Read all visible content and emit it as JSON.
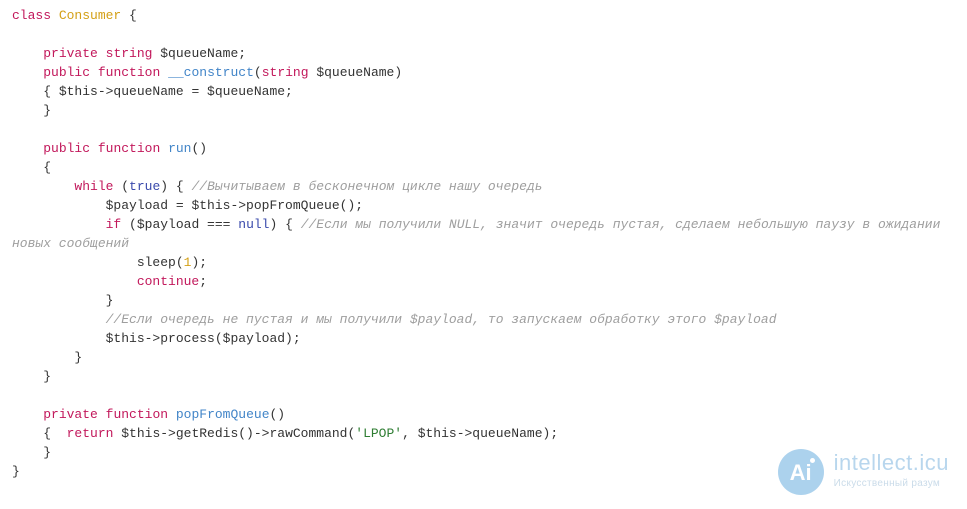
{
  "code": {
    "tokens": [
      {
        "t": "kw",
        "v": "class"
      },
      {
        "t": "punct",
        "v": " "
      },
      {
        "t": "type",
        "v": "Consumer"
      },
      {
        "t": "punct",
        "v": " {"
      },
      {
        "t": "br"
      },
      {
        "t": "br"
      },
      {
        "t": "punct",
        "v": "    "
      },
      {
        "t": "kw",
        "v": "private"
      },
      {
        "t": "punct",
        "v": " "
      },
      {
        "t": "kw",
        "v": "string"
      },
      {
        "t": "punct",
        "v": " $queueName;"
      },
      {
        "t": "br"
      },
      {
        "t": "punct",
        "v": "    "
      },
      {
        "t": "kw",
        "v": "public"
      },
      {
        "t": "punct",
        "v": " "
      },
      {
        "t": "kw",
        "v": "function"
      },
      {
        "t": "punct",
        "v": " "
      },
      {
        "t": "fn",
        "v": "__construct"
      },
      {
        "t": "punct",
        "v": "("
      },
      {
        "t": "kw",
        "v": "string"
      },
      {
        "t": "punct",
        "v": " $queueName)"
      },
      {
        "t": "br"
      },
      {
        "t": "punct",
        "v": "    { $this->queueName = $queueName;"
      },
      {
        "t": "br"
      },
      {
        "t": "punct",
        "v": "    }"
      },
      {
        "t": "br"
      },
      {
        "t": "br"
      },
      {
        "t": "punct",
        "v": "    "
      },
      {
        "t": "kw",
        "v": "public"
      },
      {
        "t": "punct",
        "v": " "
      },
      {
        "t": "kw",
        "v": "function"
      },
      {
        "t": "punct",
        "v": " "
      },
      {
        "t": "fn",
        "v": "run"
      },
      {
        "t": "punct",
        "v": "()"
      },
      {
        "t": "br"
      },
      {
        "t": "punct",
        "v": "    {"
      },
      {
        "t": "br"
      },
      {
        "t": "punct",
        "v": "        "
      },
      {
        "t": "kw",
        "v": "while"
      },
      {
        "t": "punct",
        "v": " ("
      },
      {
        "t": "bool",
        "v": "true"
      },
      {
        "t": "punct",
        "v": ") { "
      },
      {
        "t": "cmt",
        "v": "//Вычитываем в бесконечном цикле нашу очередь"
      },
      {
        "t": "br"
      },
      {
        "t": "punct",
        "v": "            $payload = $this->popFromQueue();"
      },
      {
        "t": "br"
      },
      {
        "t": "punct",
        "v": "            "
      },
      {
        "t": "kw",
        "v": "if"
      },
      {
        "t": "punct",
        "v": " ($payload === "
      },
      {
        "t": "bool",
        "v": "null"
      },
      {
        "t": "punct",
        "v": ") { "
      },
      {
        "t": "cmt",
        "v": "//Если мы получили NULL, значит очередь пустая, сделаем небольшую паузу в ожидании новых сообщений"
      },
      {
        "t": "br"
      },
      {
        "t": "punct",
        "v": "                sleep("
      },
      {
        "t": "num",
        "v": "1"
      },
      {
        "t": "punct",
        "v": ");"
      },
      {
        "t": "br"
      },
      {
        "t": "punct",
        "v": "                "
      },
      {
        "t": "kw",
        "v": "continue"
      },
      {
        "t": "punct",
        "v": ";"
      },
      {
        "t": "br"
      },
      {
        "t": "punct",
        "v": "            }"
      },
      {
        "t": "br"
      },
      {
        "t": "punct",
        "v": "            "
      },
      {
        "t": "cmt",
        "v": "//Если очередь не пустая и мы получили $payload, то запускаем обработку этого $payload"
      },
      {
        "t": "br"
      },
      {
        "t": "punct",
        "v": "            $this->process($payload);"
      },
      {
        "t": "br"
      },
      {
        "t": "punct",
        "v": "        }"
      },
      {
        "t": "br"
      },
      {
        "t": "punct",
        "v": "    }"
      },
      {
        "t": "br"
      },
      {
        "t": "br"
      },
      {
        "t": "punct",
        "v": "    "
      },
      {
        "t": "kw",
        "v": "private"
      },
      {
        "t": "punct",
        "v": " "
      },
      {
        "t": "kw",
        "v": "function"
      },
      {
        "t": "punct",
        "v": " "
      },
      {
        "t": "fn",
        "v": "popFromQueue"
      },
      {
        "t": "punct",
        "v": "()"
      },
      {
        "t": "br"
      },
      {
        "t": "punct",
        "v": "    {  "
      },
      {
        "t": "kw",
        "v": "return"
      },
      {
        "t": "punct",
        "v": " $this->getRedis()->rawCommand("
      },
      {
        "t": "str",
        "v": "'LPOP'"
      },
      {
        "t": "punct",
        "v": ", $this->queueName);"
      },
      {
        "t": "br"
      },
      {
        "t": "punct",
        "v": "    }"
      },
      {
        "t": "br"
      },
      {
        "t": "punct",
        "v": "}"
      }
    ]
  },
  "watermark": {
    "badge": "Ai",
    "title": "intellect.icu",
    "subtitle": "Искусственный разум"
  }
}
